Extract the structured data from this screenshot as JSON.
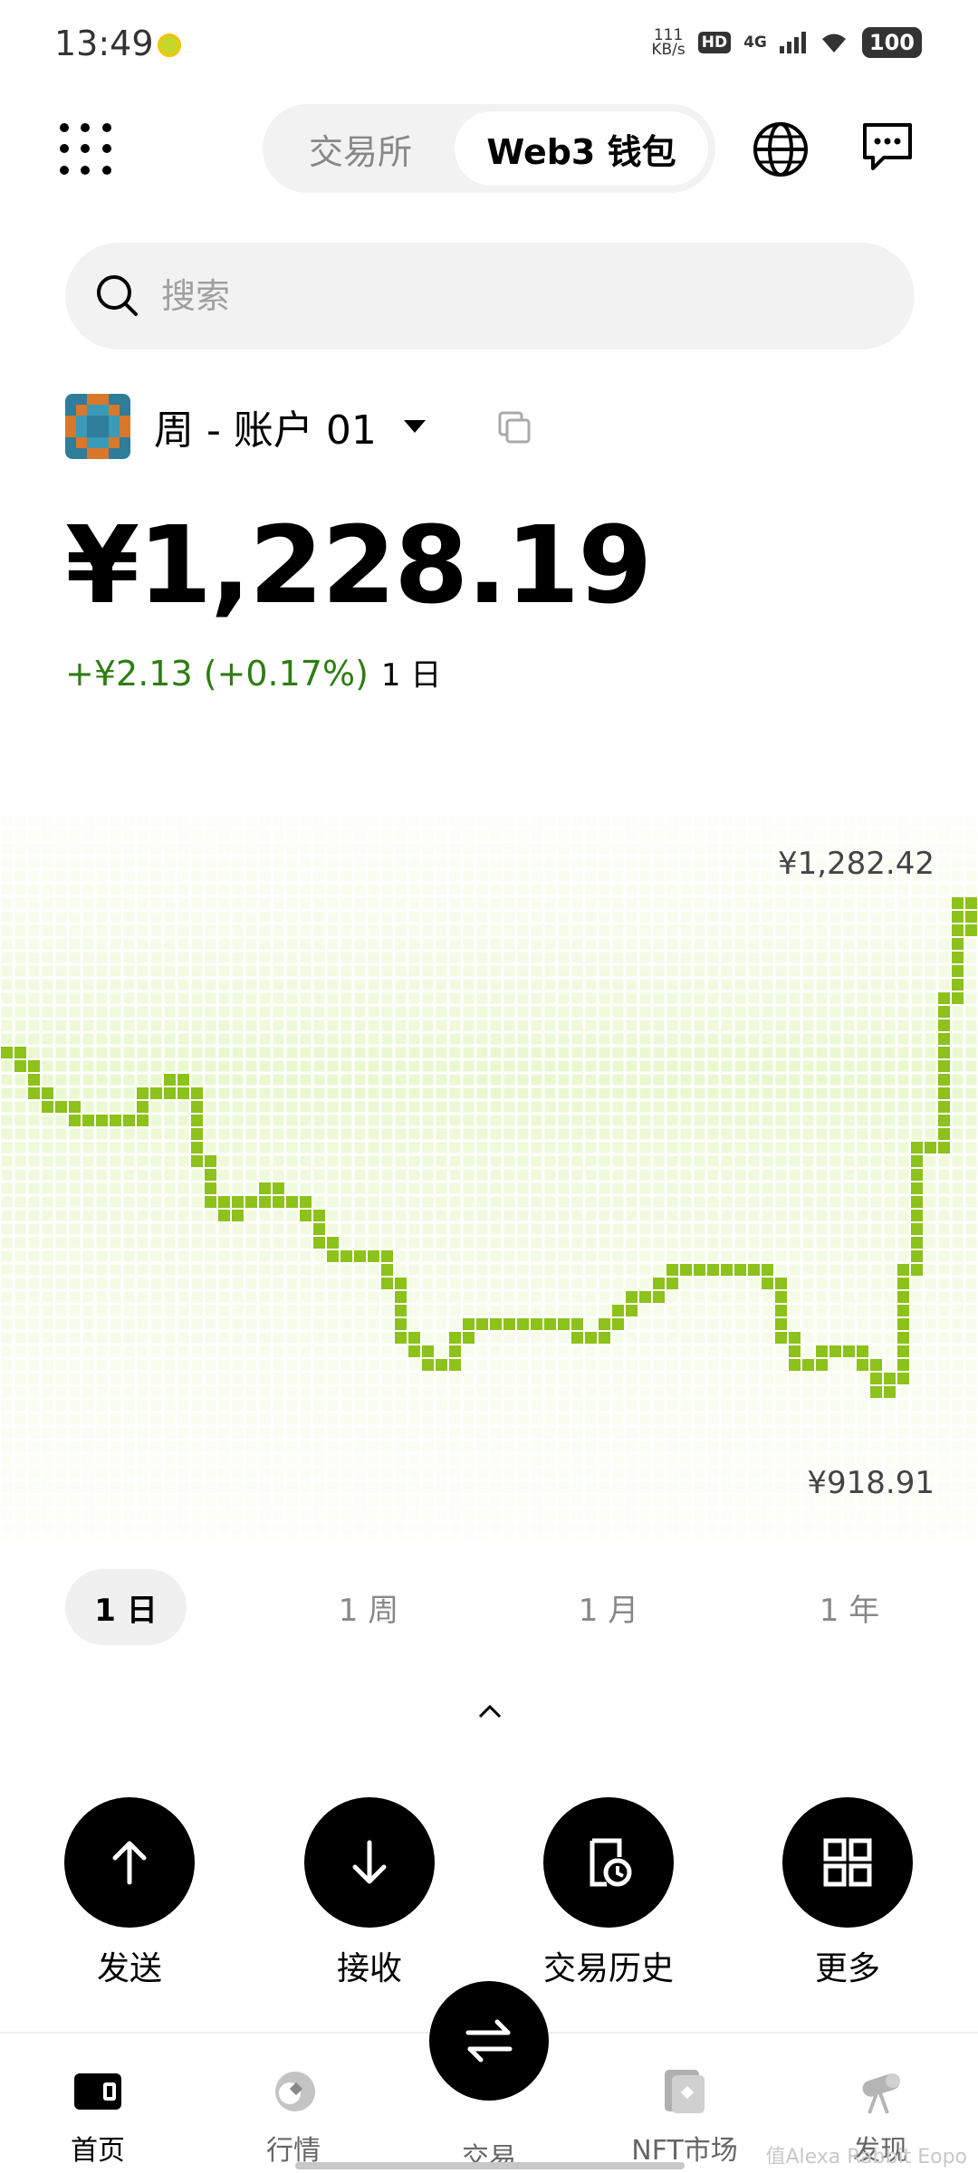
{
  "status_bar": {
    "time": "13:49",
    "speed_value": "111",
    "speed_unit": "KB/s",
    "hd": "HD",
    "network": "4G",
    "battery": "100"
  },
  "header": {
    "tabs": [
      {
        "label": "交易所",
        "active": false
      },
      {
        "label": "Web3 钱包",
        "active": true
      }
    ],
    "icons": [
      "grid-menu-icon",
      "globe-icon",
      "message-icon"
    ]
  },
  "search": {
    "placeholder": "搜索"
  },
  "account": {
    "name": "周 - 账户 01"
  },
  "balance": {
    "amount": "¥1,228.19",
    "change": "+¥2.13 (+0.17%)",
    "period": "1 日",
    "change_color": "#2e7d12"
  },
  "chart_data": {
    "type": "line",
    "max_label": "¥1,282.42",
    "min_label": "¥918.91",
    "ylim": [
      918.91,
      1282.42
    ],
    "color": "#8cc21a",
    "values": [
      1185,
      1178,
      1160,
      1148,
      1142,
      1142,
      1142,
      1135,
      1142,
      1158,
      1170,
      1160,
      1110,
      1085,
      1075,
      1085,
      1095,
      1090,
      1082,
      1075,
      1060,
      1050,
      1050,
      1048,
      1035,
      1000,
      985,
      980,
      995,
      1003,
      1003,
      1008,
      1008,
      1008,
      1008,
      1003,
      996,
      996,
      1003,
      1012,
      1022,
      1035,
      1042,
      1042,
      1042,
      1042,
      1042,
      1040,
      1035,
      995,
      980,
      975,
      990,
      985,
      978,
      962,
      970,
      1045,
      1120,
      1220,
      1282,
      1265,
      1260
    ]
  },
  "periods": [
    "1 日",
    "1 周",
    "1 月",
    "1 年"
  ],
  "active_period": 0,
  "actions": [
    {
      "label": "发送",
      "icon": "arrow-up-icon"
    },
    {
      "label": "接收",
      "icon": "arrow-down-icon"
    },
    {
      "label": "交易历史",
      "icon": "history-icon"
    },
    {
      "label": "更多",
      "icon": "apps-icon"
    }
  ],
  "bottom_nav": [
    {
      "label": "首页",
      "icon": "wallet-icon",
      "active": true
    },
    {
      "label": "行情",
      "icon": "market-icon",
      "active": false
    },
    {
      "label": "交易",
      "icon": "swap-icon",
      "active": false
    },
    {
      "label": "NFT市场",
      "icon": "nft-icon",
      "active": false
    },
    {
      "label": "发现",
      "icon": "discover-icon",
      "active": false
    }
  ],
  "watermark": "值Alexa Rabbit Eopo"
}
